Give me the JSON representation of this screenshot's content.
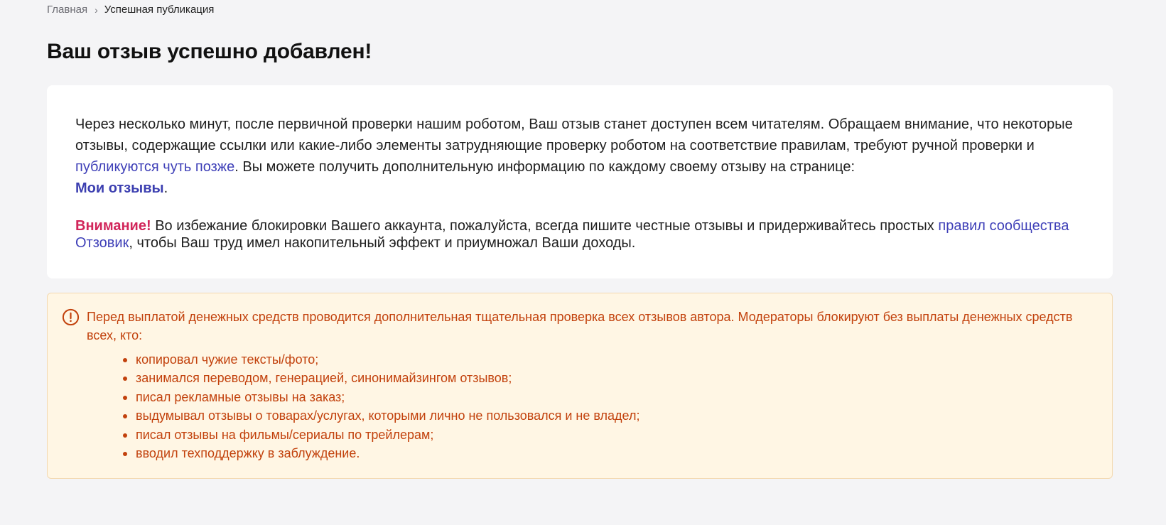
{
  "breadcrumb": {
    "home_label": "Главная",
    "separator": "›",
    "current_label": "Успешная публикация"
  },
  "page": {
    "title": "Ваш отзыв успешно добавлен!"
  },
  "card": {
    "para1_text1": "Через несколько минут, после первичной проверки нашим роботом, Ваш отзыв станет доступен всем читателям. Обращаем внимание, что некоторые отзывы, содержащие ссылки или какие-либо элементы затрудняющие проверку роботом на соответствие правилам, требуют ручной проверки и ",
    "para1_link_later": "публикуются чуть позже",
    "para1_text2": ". Вы можете получить дополнительную информацию по каждому своему отзыву на странице: ",
    "para1_link_my_reviews": "Мои отзывы",
    "para1_text3": ".",
    "para2_warning_label": "Внимание!",
    "para2_text1": " Во избежание блокировки Вашего аккаунта, пожалуйста, всегда пишите честные отзывы и придерживайтесь простых ",
    "para2_link_rules": "правил сообщества Отзовик",
    "para2_text2": ", чтобы Ваш труд имел накопительный эффект и приумножал Ваши доходы."
  },
  "notice": {
    "icon": "exclamation-circle-icon",
    "text": "Перед выплатой денежных средств проводится дополнительная тщательная проверка всех отзывов автора. Модераторы блокируют без выплаты денежных средств всех, кто:",
    "items": [
      "копировал чужие тексты/фото;",
      "занимался переводом, генерацией, синонимайзингом отзывов;",
      "писал рекламные отзывы на заказ;",
      "выдумывал отзывы о товарах/услугах, которыми лично не пользовался и не владел;",
      "писал отзывы на фильмы/сериалы по трейлерам;",
      "вводил техподдержку в заблуждение."
    ]
  },
  "colors": {
    "background": "#f4f4f6",
    "link": "#3f40b8",
    "warning": "#d1255a",
    "notice_text": "#c2410c",
    "notice_bg": "#fff6e4"
  }
}
